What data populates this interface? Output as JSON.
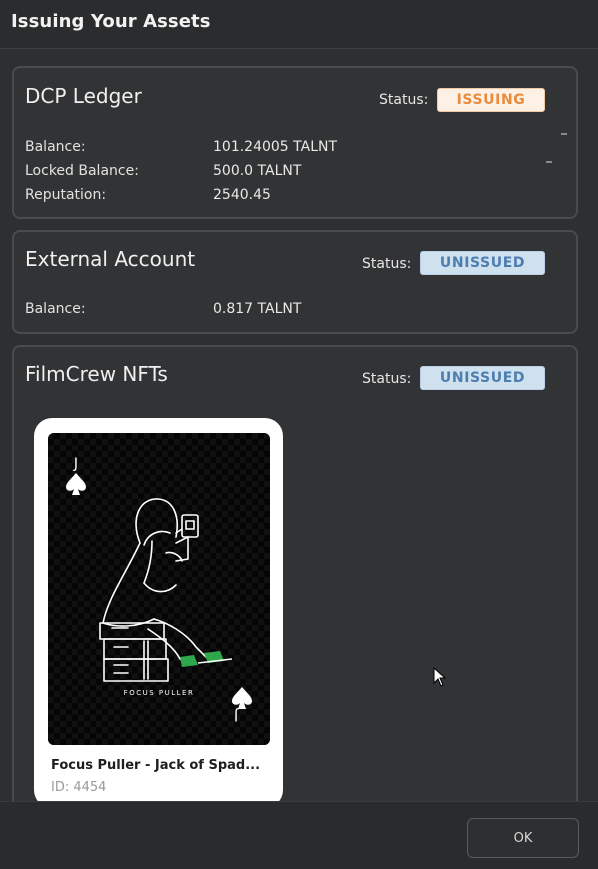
{
  "dialog": {
    "title": "Issuing Your Assets"
  },
  "dcp_ledger": {
    "title": "DCP Ledger",
    "status_label": "Status:",
    "status": "ISSUING",
    "rows": [
      {
        "label": "Balance:",
        "value": "101.24005 TALNT"
      },
      {
        "label": "Locked Balance:",
        "value": "500.0 TALNT"
      },
      {
        "label": "Reputation:",
        "value": "2540.45"
      }
    ]
  },
  "external_account": {
    "title": "External Account",
    "status_label": "Status:",
    "status": "UNISSUED",
    "rows": [
      {
        "label": "Balance:",
        "value": "0.817 TALNT"
      }
    ]
  },
  "nfts": {
    "title": "FilmCrew NFTs",
    "status_label": "Status:",
    "status": "UNISSUED",
    "card": {
      "name": "Focus Puller - Jack of Spad...",
      "id": "ID: 4454",
      "rank_top": "J",
      "rank_bottom": "J",
      "caption": "FOCUS PULLER"
    }
  },
  "footer": {
    "ok_label": "OK"
  },
  "colors": {
    "issuing_text": "#e98b3c",
    "unissued_text": "#4d7eb0",
    "background": "#2e2f30"
  }
}
